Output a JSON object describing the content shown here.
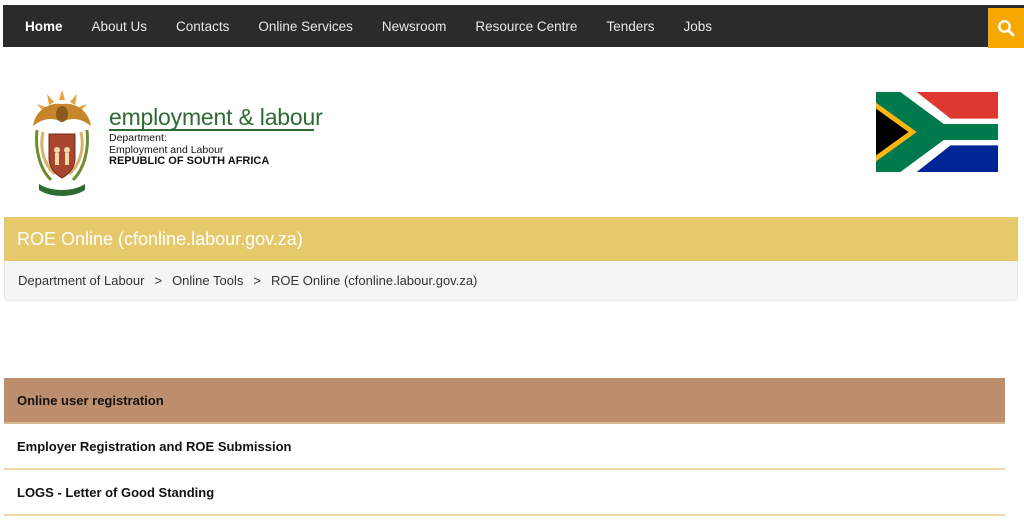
{
  "nav": {
    "items": [
      {
        "label": "Home",
        "active": true
      },
      {
        "label": "About Us"
      },
      {
        "label": "Contacts"
      },
      {
        "label": "Online Services"
      },
      {
        "label": "Newsroom"
      },
      {
        "label": "Resource Centre"
      },
      {
        "label": "Tenders"
      },
      {
        "label": "Jobs"
      }
    ],
    "search_icon": "search-icon",
    "search_color": "#f5a800"
  },
  "header": {
    "dept_title": "employment & labour",
    "line1": "Department:",
    "line2": "Employment and Labour",
    "line3": "REPUBLIC OF SOUTH AFRICA",
    "crest_icon": "coat-of-arms-logo",
    "flag_icon": "south-africa-flag"
  },
  "page": {
    "title": "ROE Online (cfonline.labour.gov.za)"
  },
  "breadcrumb": {
    "items": [
      "Department of Labour",
      "Online Tools",
      "ROE Online (cfonline.labour.gov.za)"
    ],
    "separator": ">"
  },
  "menu": {
    "items": [
      {
        "label": "Online user registration",
        "active": true
      },
      {
        "label": "Employer Registration and ROE Submission"
      },
      {
        "label": "LOGS - Letter of Good Standing"
      }
    ]
  },
  "colors": {
    "nav_bg": "#2b2b2b",
    "title_bar": "#e5c96b",
    "menu_active": "#bd8e6d",
    "dept_green": "#2e6a33"
  }
}
